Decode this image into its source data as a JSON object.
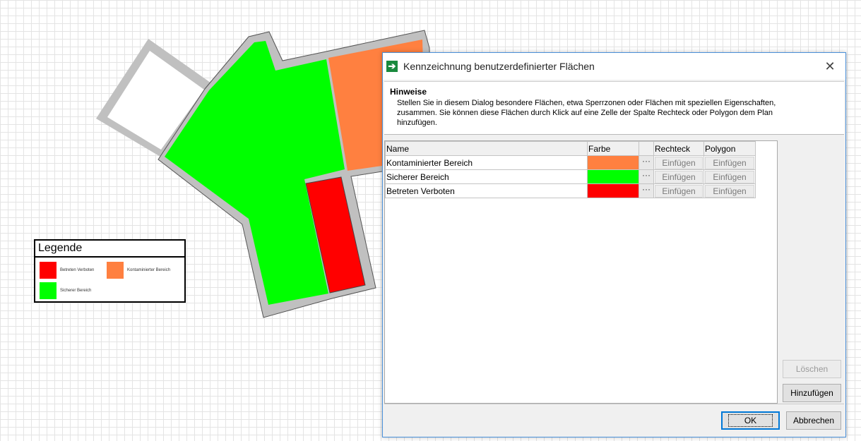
{
  "legend": {
    "title": "Legende",
    "entries": [
      {
        "label": "Betreten Verboten",
        "color": "#ff0000"
      },
      {
        "label": "Kontaminierter Bereich",
        "color": "#ff8040"
      },
      {
        "label": "Sicherer Bereich",
        "color": "#00ff00"
      }
    ]
  },
  "floorplan": {
    "wall_color": "#c0c0c0",
    "zone_colors": {
      "contaminated": "#ff8040",
      "safe": "#00ff00",
      "forbidden": "#ff0000"
    }
  },
  "dialog": {
    "title": "Kennzeichnung benutzerdefinierter Flächen",
    "icon": "arrow-right-icon",
    "close_symbol": "✕",
    "hint_title": "Hinweise",
    "hint_text": "Stellen Sie in diesem Dialog  besondere Flächen, etwa Sperrzonen oder Flächen mit speziellen Eigenschaften, zusammen. Sie können diese Flächen durch Klick auf eine Zelle der Spalte Rechteck oder Polygon dem Plan hinzufügen.",
    "columns": {
      "name": "Name",
      "color": "Farbe",
      "dots": "",
      "rect": "Rechteck",
      "poly": "Polygon"
    },
    "rows": [
      {
        "name": "Kontaminierter Bereich",
        "color": "#ff8040",
        "dots": "···",
        "rect": "Einfügen",
        "poly": "Einfügen"
      },
      {
        "name": "Sicherer Bereich",
        "color": "#00ff00",
        "dots": "···",
        "rect": "Einfügen",
        "poly": "Einfügen"
      },
      {
        "name": "Betreten Verboten",
        "color": "#ff0000",
        "dots": "···",
        "rect": "Einfügen",
        "poly": "Einfügen"
      }
    ],
    "buttons": {
      "delete": "Löschen",
      "add": "Hinzufügen",
      "ok": "OK",
      "cancel": "Abbrechen"
    }
  }
}
